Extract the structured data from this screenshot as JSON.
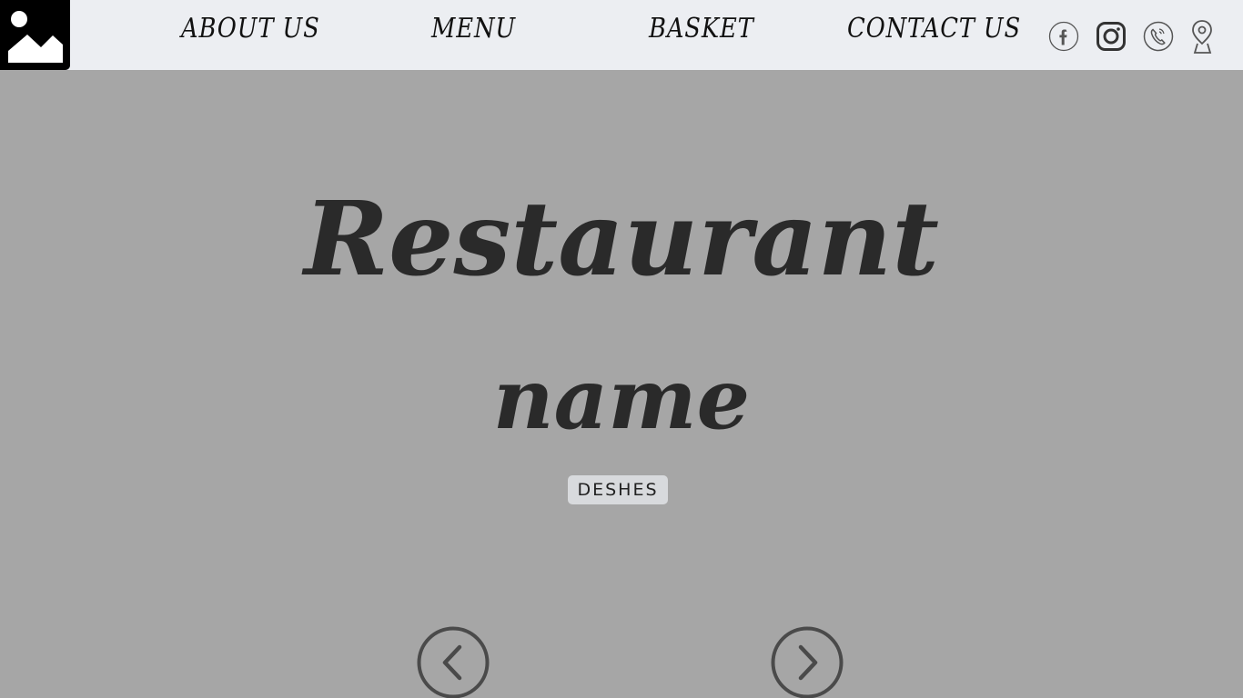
{
  "nav": {
    "about": "ABOUT US",
    "menu": "MENU",
    "basket": "BASKET",
    "contact": "CONTACT US"
  },
  "social_icons": [
    "facebook-icon",
    "instagram-icon",
    "phone-icon",
    "map-pin-icon"
  ],
  "hero": {
    "title_line1": "Restaurant",
    "title_line2": "name",
    "badge": "DESHES"
  },
  "colors": {
    "topbar_bg": "#eceef2",
    "page_bg": "#a6a6a6",
    "logo_bg": "#000000",
    "title_text": "#2a2a2a",
    "badge_bg": "#d8dadd",
    "icon_stroke": "#555555"
  }
}
